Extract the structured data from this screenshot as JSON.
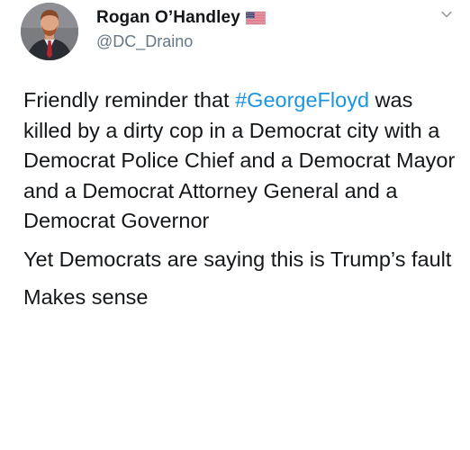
{
  "tweet": {
    "display_name": "Rogan O’Handley",
    "handle": "@DC_Draino",
    "flag_icon": "us-flag-icon",
    "menu_icon": "chevron-down-icon",
    "paragraph1_before": "Friendly reminder that ",
    "hashtag": "#GeorgeFloyd",
    "paragraph1_after": " was killed by a dirty cop in a Democrat city with a Democrat Police Chief and a Democrat Mayor and a Democrat Attorney General and a Democrat Governor",
    "paragraph2": "Yet Democrats are saying this is Trump’s fault",
    "paragraph3": "Makes sense",
    "colors": {
      "hashtag": "#1b95e0",
      "handle": "#657786",
      "text": "#14171a"
    }
  }
}
